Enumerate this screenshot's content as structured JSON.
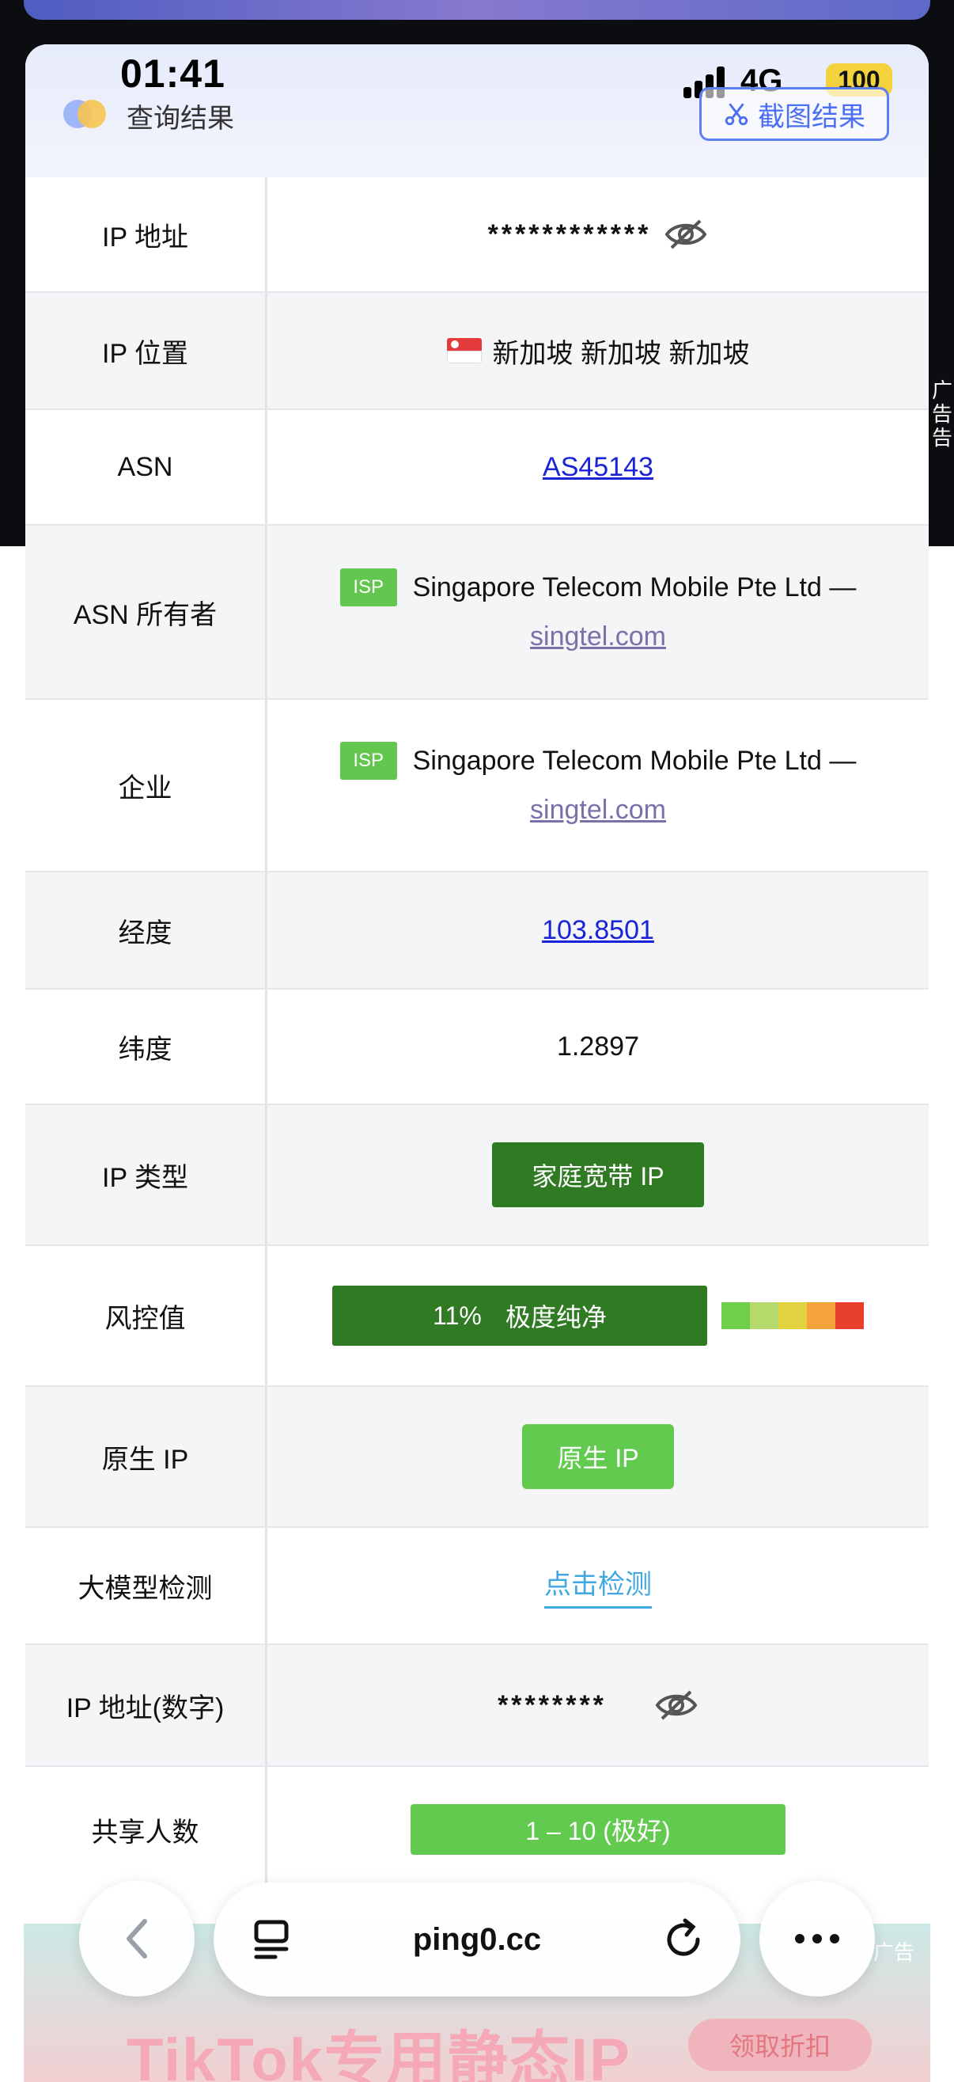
{
  "status_bar": {
    "time": "01:41",
    "network": "4G",
    "battery": "100"
  },
  "header": {
    "title": "查询结果",
    "screenshot_button": "截图结果"
  },
  "side_ad_label": "广\n告",
  "rows": [
    {
      "label": "IP 地址",
      "value": "************"
    },
    {
      "label": "IP 位置",
      "value": "新加坡 新加坡 新加坡"
    },
    {
      "label": "ASN",
      "value": "AS45143"
    },
    {
      "label": "ASN 所有者",
      "badge": "ISP",
      "name": "Singapore Telecom Mobile Pte Ltd —",
      "domain": "singtel.com"
    },
    {
      "label": "企业",
      "badge": "ISP",
      "name": "Singapore Telecom Mobile Pte Ltd —",
      "domain": "singtel.com"
    },
    {
      "label": "经度",
      "value": "103.8501"
    },
    {
      "label": "纬度",
      "value": "1.2897"
    },
    {
      "label": "IP 类型",
      "value": "家庭宽带 IP"
    },
    {
      "label": "风控值",
      "percent": "11%",
      "value": "极度纯净",
      "scale_colors": [
        "#6fcf4a",
        "#b5d96a",
        "#e2d23f",
        "#f3a33a",
        "#e8402d"
      ]
    },
    {
      "label": "原生 IP",
      "value": "原生 IP"
    },
    {
      "label": "大模型检测",
      "value": "点击检测"
    },
    {
      "label": "IP 地址(数字)",
      "value": "********"
    },
    {
      "label": "共享人数",
      "value": "1 – 10 (极好)"
    }
  ],
  "bottom_ad": {
    "headline": "TikTok专用静态IP",
    "cta": "领取折扣",
    "label": "广告"
  },
  "browser": {
    "url": "ping0.cc"
  },
  "colors": {
    "accent_blue": "#4a6ff0",
    "dark_green": "#2f7a23",
    "green": "#63ca50",
    "link_blue": "#1a23d6"
  }
}
